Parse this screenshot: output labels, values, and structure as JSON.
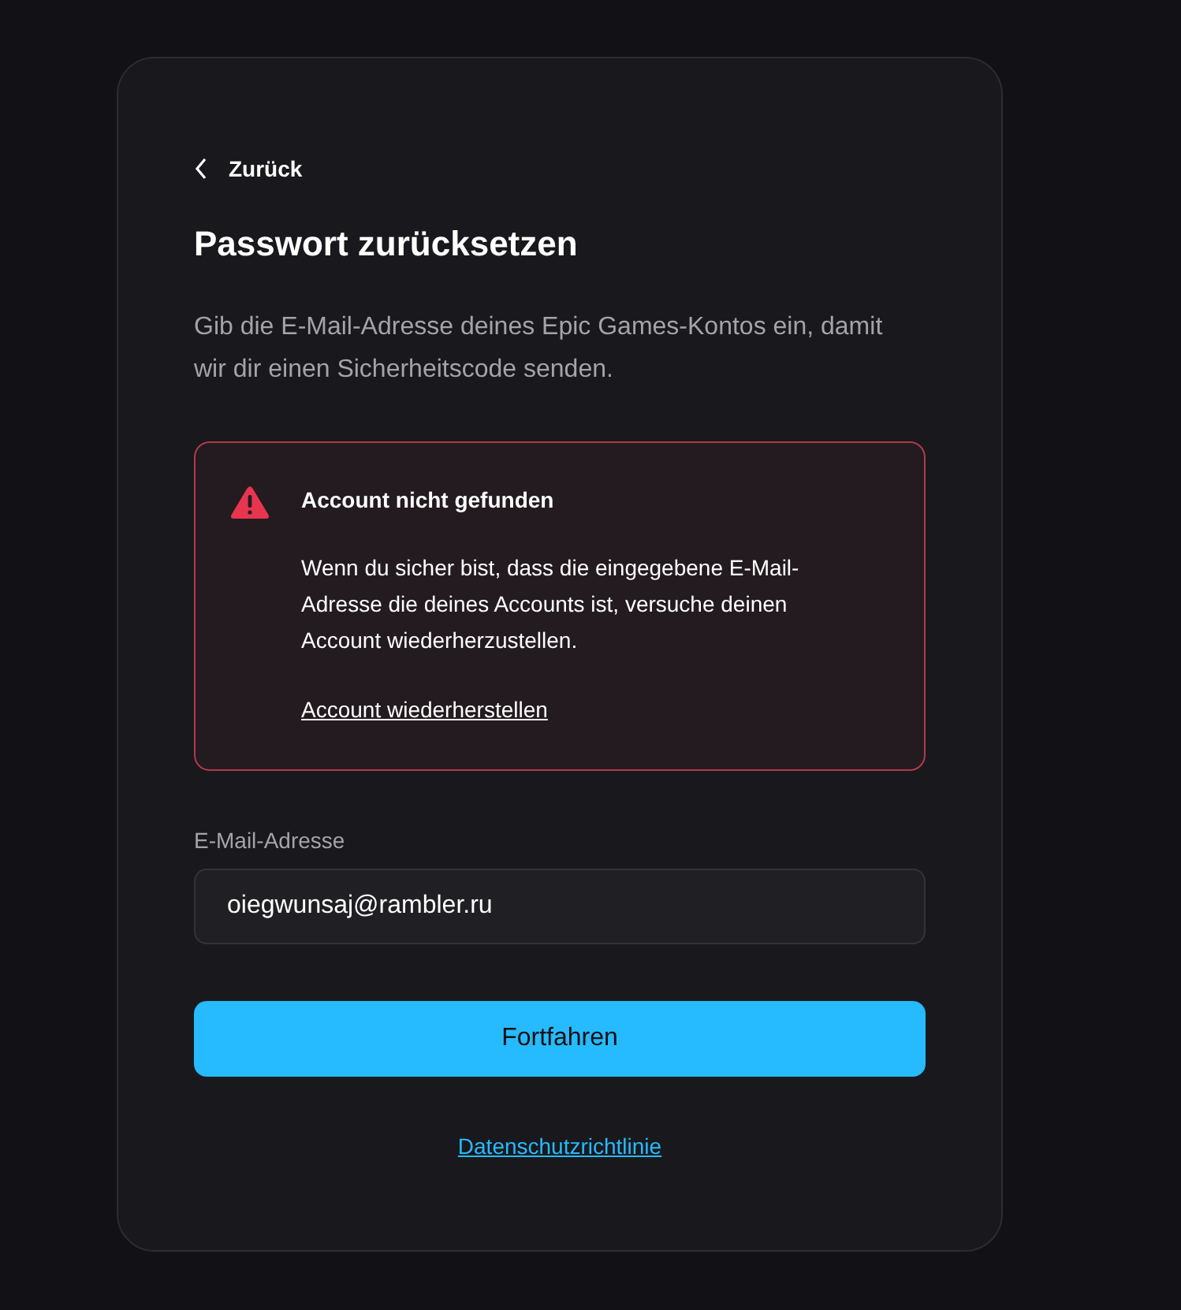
{
  "back_link": "Zurück",
  "title": "Passwort zurücksetzen",
  "description": "Gib die E-Mail-Adresse deines Epic Games-Kontos ein, damit wir dir einen Sicherheitscode senden.",
  "alert": {
    "kind": "error",
    "title": "Account nicht gefunden",
    "message": "Wenn du sicher bist, dass die eingegebene E-Mail-Adresse die deines Accounts ist, versuche deinen Account wiederherzustellen.",
    "link": "Account wiederherstellen"
  },
  "email_field": {
    "label": "E-Mail-Adresse",
    "value": "oiegwunsaj@rambler.ru"
  },
  "submit_button": "Fortfahren",
  "footer_link": "Datenschutzrichtlinie"
}
